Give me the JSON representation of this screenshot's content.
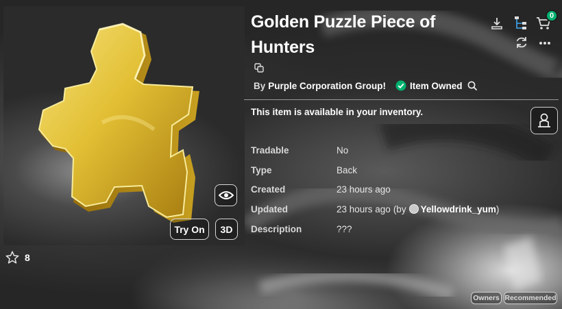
{
  "item": {
    "title": "Golden Puzzle Piece of Hunters",
    "by_label": "By",
    "creator": "Purple Corporation Group!",
    "owned_label": "Item Owned",
    "availability": "This item is available in your inventory.",
    "favorites": "8"
  },
  "preview": {
    "try_on_label": "Try On",
    "view3d_label": "3D"
  },
  "details": [
    {
      "label": "Tradable",
      "value": "No"
    },
    {
      "label": "Type",
      "value": "Back"
    },
    {
      "label": "Created",
      "value": "23 hours ago"
    },
    {
      "label": "Updated",
      "value": "23 hours ago",
      "prefix": "(by",
      "user": "Yellowdrink_yum",
      "suffix": ")"
    },
    {
      "label": "Description",
      "value": "???"
    }
  ],
  "toolbar": {
    "cart_count": "0"
  },
  "chips": {
    "owners": "Owners",
    "recommended": "Recommended"
  },
  "colors": {
    "accent_green": "#00b06f",
    "gold": "#e3c13a"
  },
  "icons": [
    "download-icon",
    "hierarchy-icon",
    "cart-icon",
    "refresh-icon",
    "more-icon",
    "copy-icon",
    "check-circle-icon",
    "search-icon",
    "eye-icon",
    "star-icon",
    "avatar-icon"
  ]
}
